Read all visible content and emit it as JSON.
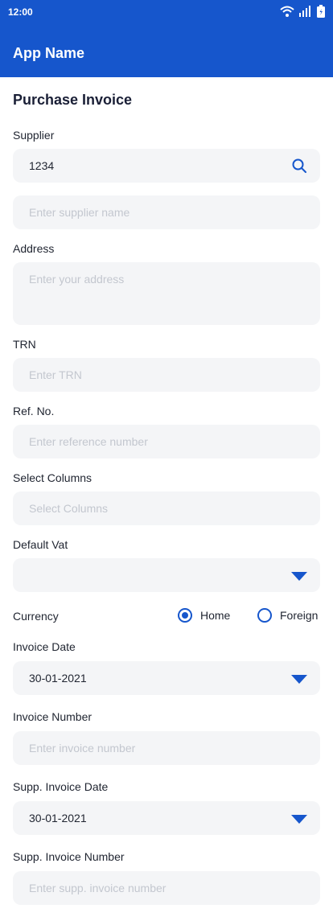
{
  "status": {
    "time": "12:00"
  },
  "app": {
    "title": "App Name"
  },
  "page": {
    "title": "Purchase Invoice"
  },
  "form": {
    "supplier": {
      "label": "Supplier",
      "value": "1234"
    },
    "supplier_name": {
      "placeholder": "Enter supplier name"
    },
    "address": {
      "label": "Address",
      "placeholder": "Enter your address"
    },
    "trn": {
      "label": "TRN",
      "placeholder": "Enter TRN"
    },
    "ref_no": {
      "label": "Ref. No.",
      "placeholder": "Enter reference number"
    },
    "select_columns": {
      "label": "Select Columns",
      "placeholder": "Select Columns"
    },
    "default_vat": {
      "label": "Default Vat",
      "value": ""
    },
    "currency": {
      "label": "Currency",
      "options": [
        "Home",
        "Foreign"
      ],
      "selected": "Home"
    },
    "invoice_date": {
      "label": "Invoice Date",
      "value": "30-01-2021"
    },
    "invoice_number": {
      "label": "Invoice Number",
      "placeholder": "Enter invoice number"
    },
    "supp_invoice_date": {
      "label": "Supp. Invoice Date",
      "value": "30-01-2021"
    },
    "supp_invoice_number": {
      "label": "Supp. Invoice Number",
      "placeholder": "Enter supp. invoice number"
    }
  },
  "colors": {
    "primary": "#1656cc",
    "field_bg": "#f4f5f7",
    "placeholder": "#c3c7cf"
  },
  "icons": [
    "wifi-icon",
    "signal-icon",
    "battery-icon",
    "search-icon",
    "dropdown-caret-icon",
    "radio-icon"
  ]
}
